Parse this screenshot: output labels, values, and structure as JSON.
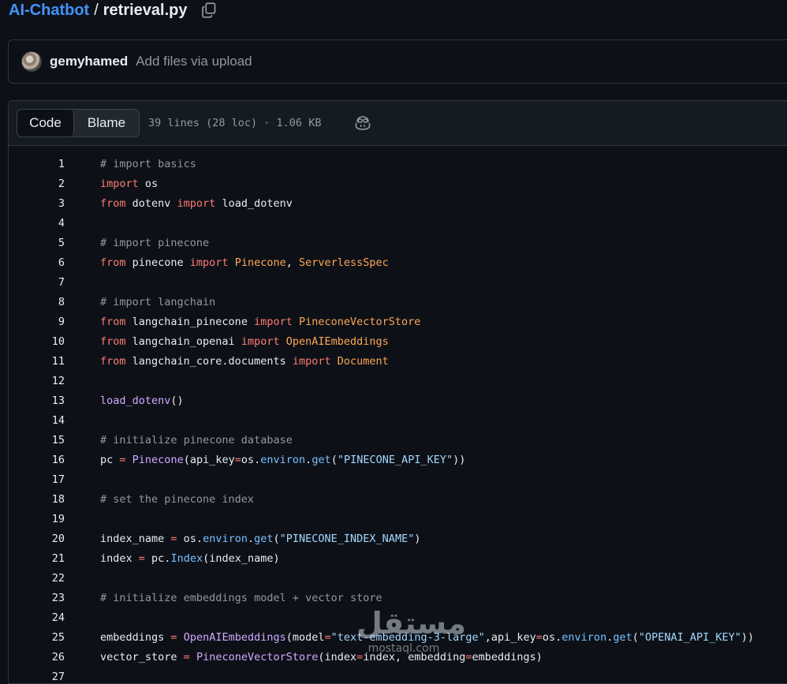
{
  "breadcrumb": {
    "repo": "AI-Chatbot",
    "separator": "/",
    "file": "retrieval.py"
  },
  "commit": {
    "author": "gemyhamed",
    "message": "Add files via upload"
  },
  "file_header": {
    "tabs": [
      {
        "label": "Code",
        "active": true
      },
      {
        "label": "Blame",
        "active": false
      }
    ],
    "meta": "39 lines (28 loc) · 1.06 KB"
  },
  "code_lines": [
    {
      "n": "1",
      "tokens": [
        {
          "t": "# import basics",
          "c": "cm"
        }
      ]
    },
    {
      "n": "2",
      "tokens": [
        {
          "t": "import",
          "c": "kw"
        },
        {
          "t": " os",
          "c": ""
        }
      ]
    },
    {
      "n": "3",
      "tokens": [
        {
          "t": "from",
          "c": "kw"
        },
        {
          "t": " dotenv ",
          "c": ""
        },
        {
          "t": "import",
          "c": "kw"
        },
        {
          "t": " load_dotenv",
          "c": ""
        }
      ]
    },
    {
      "n": "4",
      "tokens": []
    },
    {
      "n": "5",
      "tokens": [
        {
          "t": "# import pinecone",
          "c": "cm"
        }
      ]
    },
    {
      "n": "6",
      "tokens": [
        {
          "t": "from",
          "c": "kw"
        },
        {
          "t": " pinecone ",
          "c": ""
        },
        {
          "t": "import",
          "c": "kw"
        },
        {
          "t": " ",
          "c": ""
        },
        {
          "t": "Pinecone",
          "c": "cls"
        },
        {
          "t": ", ",
          "c": ""
        },
        {
          "t": "ServerlessSpec",
          "c": "cls"
        }
      ]
    },
    {
      "n": "7",
      "tokens": []
    },
    {
      "n": "8",
      "tokens": [
        {
          "t": "# import langchain",
          "c": "cm"
        }
      ]
    },
    {
      "n": "9",
      "tokens": [
        {
          "t": "from",
          "c": "kw"
        },
        {
          "t": " langchain_pinecone ",
          "c": ""
        },
        {
          "t": "import",
          "c": "kw"
        },
        {
          "t": " ",
          "c": ""
        },
        {
          "t": "PineconeVectorStore",
          "c": "cls"
        }
      ]
    },
    {
      "n": "10",
      "tokens": [
        {
          "t": "from",
          "c": "kw"
        },
        {
          "t": " langchain_openai ",
          "c": ""
        },
        {
          "t": "import",
          "c": "kw"
        },
        {
          "t": " ",
          "c": ""
        },
        {
          "t": "OpenAIEmbeddings",
          "c": "cls"
        }
      ]
    },
    {
      "n": "11",
      "tokens": [
        {
          "t": "from",
          "c": "kw"
        },
        {
          "t": " langchain_core.documents ",
          "c": ""
        },
        {
          "t": "import",
          "c": "kw"
        },
        {
          "t": " ",
          "c": ""
        },
        {
          "t": "Document",
          "c": "cls"
        }
      ]
    },
    {
      "n": "12",
      "tokens": []
    },
    {
      "n": "13",
      "tokens": [
        {
          "t": "load_dotenv",
          "c": "fn"
        },
        {
          "t": "()",
          "c": ""
        }
      ]
    },
    {
      "n": "14",
      "tokens": []
    },
    {
      "n": "15",
      "tokens": [
        {
          "t": "# initialize pinecone database",
          "c": "cm"
        }
      ]
    },
    {
      "n": "16",
      "tokens": [
        {
          "t": "pc ",
          "c": ""
        },
        {
          "t": "=",
          "c": "op"
        },
        {
          "t": " ",
          "c": ""
        },
        {
          "t": "Pinecone",
          "c": "fn"
        },
        {
          "t": "(api_key",
          "c": ""
        },
        {
          "t": "=",
          "c": "op"
        },
        {
          "t": "os.",
          "c": ""
        },
        {
          "t": "environ",
          "c": "at"
        },
        {
          "t": ".",
          "c": ""
        },
        {
          "t": "get",
          "c": "at"
        },
        {
          "t": "(",
          "c": ""
        },
        {
          "t": "\"PINECONE_API_KEY\"",
          "c": "str"
        },
        {
          "t": "))",
          "c": ""
        }
      ]
    },
    {
      "n": "17",
      "tokens": []
    },
    {
      "n": "18",
      "tokens": [
        {
          "t": "# set the pinecone index",
          "c": "cm"
        }
      ]
    },
    {
      "n": "19",
      "tokens": []
    },
    {
      "n": "20",
      "tokens": [
        {
          "t": "index_name ",
          "c": ""
        },
        {
          "t": "=",
          "c": "op"
        },
        {
          "t": " os.",
          "c": ""
        },
        {
          "t": "environ",
          "c": "at"
        },
        {
          "t": ".",
          "c": ""
        },
        {
          "t": "get",
          "c": "at"
        },
        {
          "t": "(",
          "c": ""
        },
        {
          "t": "\"PINECONE_INDEX_NAME\"",
          "c": "str"
        },
        {
          "t": ")",
          "c": ""
        }
      ]
    },
    {
      "n": "21",
      "tokens": [
        {
          "t": "index ",
          "c": ""
        },
        {
          "t": "=",
          "c": "op"
        },
        {
          "t": " pc.",
          "c": ""
        },
        {
          "t": "Index",
          "c": "at"
        },
        {
          "t": "(index_name)",
          "c": ""
        }
      ]
    },
    {
      "n": "22",
      "tokens": []
    },
    {
      "n": "23",
      "tokens": [
        {
          "t": "# initialize embeddings model + vector store",
          "c": "cm"
        }
      ]
    },
    {
      "n": "24",
      "tokens": []
    },
    {
      "n": "25",
      "tokens": [
        {
          "t": "embeddings ",
          "c": ""
        },
        {
          "t": "=",
          "c": "op"
        },
        {
          "t": " ",
          "c": ""
        },
        {
          "t": "OpenAIEmbeddings",
          "c": "fn"
        },
        {
          "t": "(model",
          "c": ""
        },
        {
          "t": "=",
          "c": "op"
        },
        {
          "t": "\"text-embedding-3-large\"",
          "c": "str"
        },
        {
          "t": ",api_key",
          "c": ""
        },
        {
          "t": "=",
          "c": "op"
        },
        {
          "t": "os.",
          "c": ""
        },
        {
          "t": "environ",
          "c": "at"
        },
        {
          "t": ".",
          "c": ""
        },
        {
          "t": "get",
          "c": "at"
        },
        {
          "t": "(",
          "c": ""
        },
        {
          "t": "\"OPENAI_API_KEY\"",
          "c": "str"
        },
        {
          "t": "))",
          "c": ""
        }
      ]
    },
    {
      "n": "26",
      "tokens": [
        {
          "t": "vector_store ",
          "c": ""
        },
        {
          "t": "=",
          "c": "op"
        },
        {
          "t": " ",
          "c": ""
        },
        {
          "t": "PineconeVectorStore",
          "c": "fn"
        },
        {
          "t": "(index",
          "c": ""
        },
        {
          "t": "=",
          "c": "op"
        },
        {
          "t": "index, embedding",
          "c": ""
        },
        {
          "t": "=",
          "c": "op"
        },
        {
          "t": "embeddings)",
          "c": ""
        }
      ]
    },
    {
      "n": "27",
      "tokens": []
    }
  ],
  "watermark": {
    "word": "مستقل",
    "site": "mostaql.com"
  },
  "icons": {
    "copy": "copy-icon",
    "copilot": "copilot-icon"
  },
  "colors": {
    "background": "#0d1117",
    "link": "#4493f8",
    "keyword": "#ff7b72",
    "comment": "#9198a1",
    "function": "#d2a8ff",
    "class": "#ffa657",
    "attribute": "#79c0ff",
    "string": "#a5d6ff"
  }
}
